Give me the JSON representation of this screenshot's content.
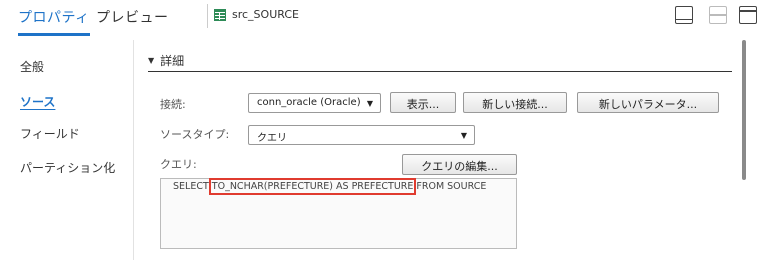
{
  "tabs": {
    "properties": "プロパティ",
    "preview": "プレビュー",
    "object_name": "src_SOURCE"
  },
  "sidebar": {
    "items": [
      {
        "label": "全般"
      },
      {
        "label": "ソース"
      },
      {
        "label": "フィールド"
      },
      {
        "label": "パーティション化"
      }
    ],
    "active_index": 1
  },
  "section": {
    "title": "詳細"
  },
  "form": {
    "connection_label": "接続:",
    "connection_value": "conn_oracle (Oracle)",
    "show_button": "表示...",
    "new_connection_button": "新しい接続...",
    "new_parameter_button": "新しいパラメータ...",
    "source_type_label": "ソースタイプ:",
    "source_type_value": "クエリ",
    "query_label": "クエリ:",
    "edit_query_button": "クエリの編集...",
    "query_prefix": "SELECT ",
    "query_highlight": "TO_NCHAR(PREFECTURE) AS PREFECTURE",
    "query_suffix": " FROM SOURCE"
  },
  "colors": {
    "accent": "#1e73c8",
    "highlight_border": "#e03b2f"
  }
}
